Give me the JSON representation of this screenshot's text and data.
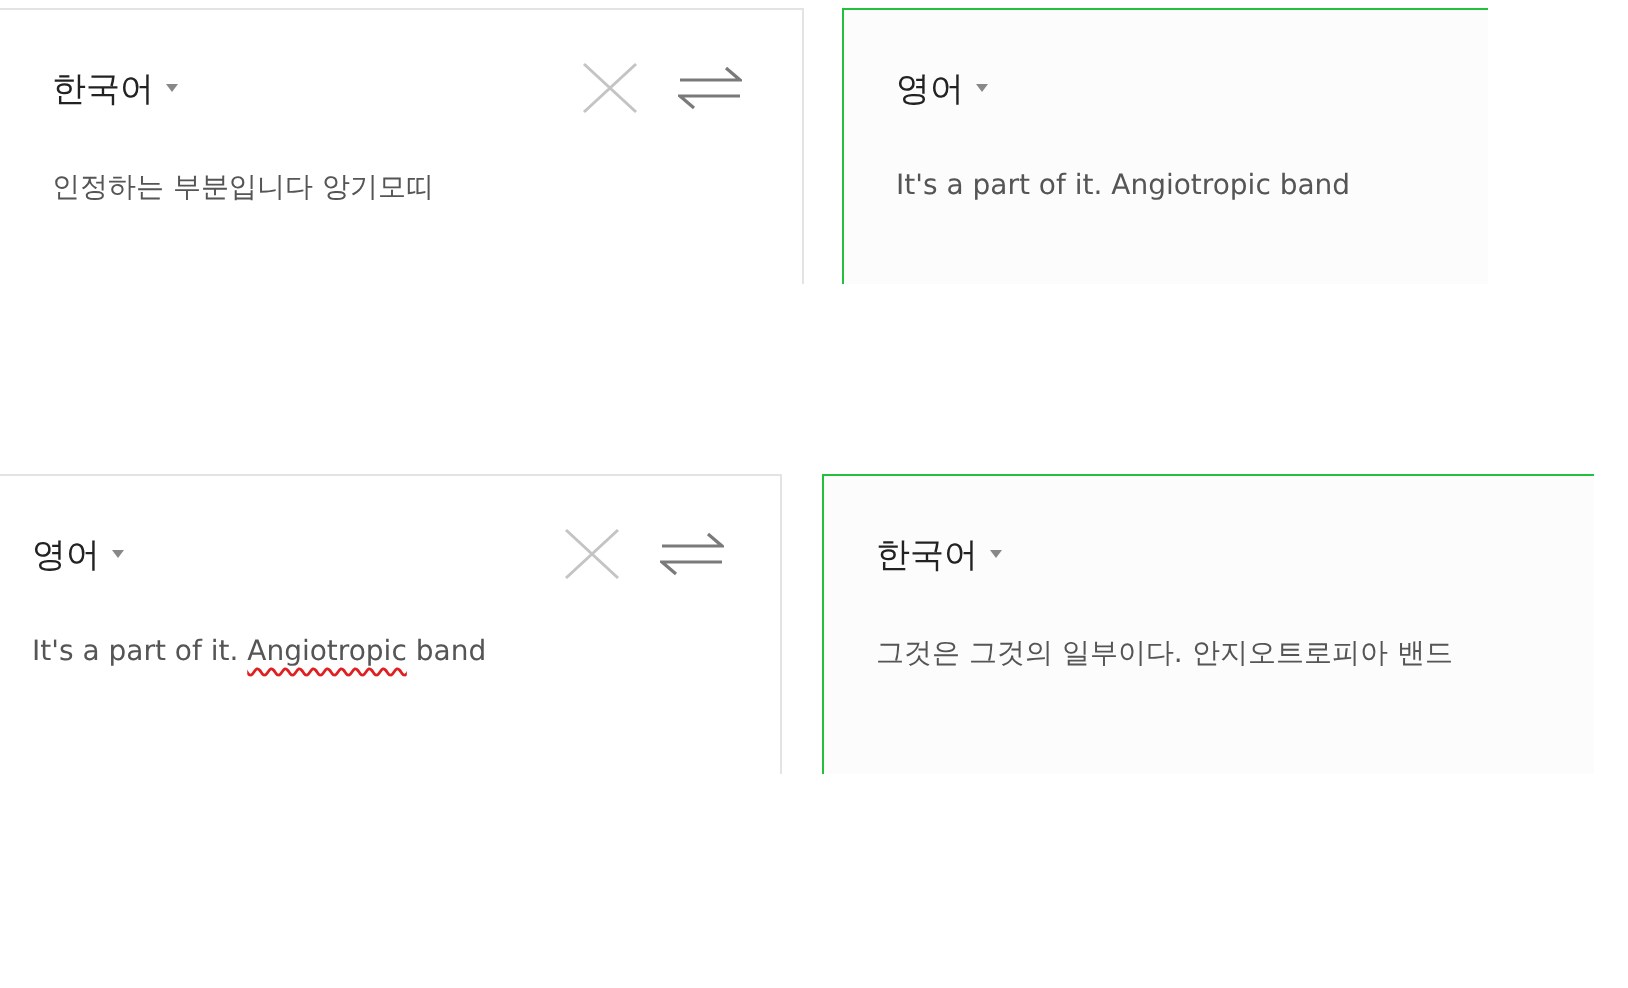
{
  "translations": [
    {
      "source": {
        "language": "한국어",
        "segments": [
          {
            "text": "인정하는 부분입니다 앙기모띠",
            "misspelled": false
          }
        ]
      },
      "target": {
        "language": "영어",
        "text": "It's a part of it. Angiotropic band"
      }
    },
    {
      "source": {
        "language": "영어",
        "segments": [
          {
            "text": "It's a part of it. ",
            "misspelled": false
          },
          {
            "text": "Angiotropic",
            "misspelled": true
          },
          {
            "text": " band",
            "misspelled": false
          }
        ]
      },
      "target": {
        "language": "한국어",
        "text": "그것은 그것의 일부이다. 안지오트로피아 밴드"
      }
    }
  ]
}
